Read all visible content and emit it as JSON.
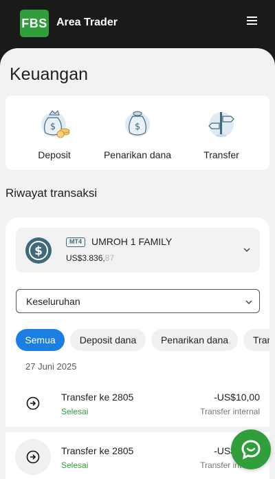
{
  "header": {
    "logo_text": "FBS",
    "app_title": "Area Trader",
    "menu_icon": "hamburger-menu-icon"
  },
  "page": {
    "title": "Keuangan"
  },
  "actions": [
    {
      "label": "Deposit",
      "icon": "money-bag-coins-icon"
    },
    {
      "label": "Penarikan dana",
      "icon": "money-bag-withdraw-icon"
    },
    {
      "label": "Transfer",
      "icon": "signpost-transfer-icon"
    }
  ],
  "history": {
    "title": "Riwayat transaksi",
    "account": {
      "platform_badge": "MT4",
      "name": "UMROH 1 FAMILY",
      "balance_main": "US$3.836,",
      "balance_cents": "87",
      "icon": "dollar-circle-icon"
    },
    "filter_select": {
      "value": "Keseluruhan"
    },
    "chips": [
      "Semua",
      "Deposit dana",
      "Penarikan dana",
      "Transfer"
    ],
    "active_chip": "Semua",
    "date": "27 Juni 2025",
    "transactions": [
      {
        "title": "Transfer ke 2805",
        "status": "Selesai",
        "amount": "-US$10,00",
        "type": "Transfer internal"
      },
      {
        "title": "Transfer ke 2805",
        "status": "Selesai",
        "amount": "-US$10,00",
        "type": "Transfer internal"
      }
    ]
  },
  "chat": {
    "icon": "chat-bubble-icon"
  },
  "colors": {
    "brand_green": "#2f9e3b",
    "active_chip_blue": "#1a7fe0",
    "account_icon": "#3e6a7a",
    "header_bg": "#1a1a1a"
  }
}
